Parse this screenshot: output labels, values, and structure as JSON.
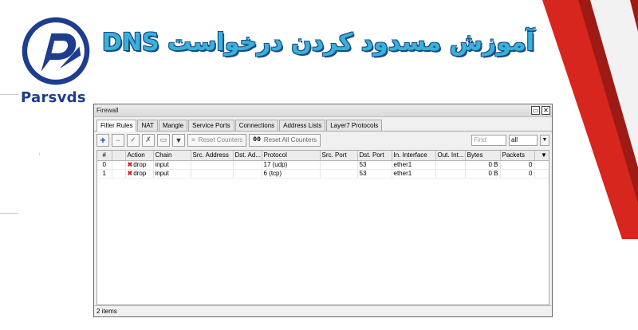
{
  "brand": {
    "name": "Parsvds"
  },
  "headline": "آموزش مسدود کردن درخواست DNS",
  "colors": {
    "brand_blue": "#1d3d8f",
    "headline_cyan": "#39b1d8",
    "accent_red": "#d7261e",
    "drop_red": "#d02020"
  },
  "window": {
    "title": "Firewall",
    "controls": {
      "restore": "▭",
      "close": "✕"
    },
    "tabs": [
      "Filter Rules",
      "NAT",
      "Mangle",
      "Service Ports",
      "Connections",
      "Address Lists",
      "Layer7 Protocols"
    ],
    "active_tab": "Filter Rules",
    "toolbar": {
      "add": "+",
      "remove": "−",
      "enable": "✓",
      "disable": "✗",
      "comment": "▭",
      "filter": "▼",
      "reset_counters": "Reset Counters",
      "reset_counters_icon": "≡",
      "reset_all_counters": "Reset All Counters",
      "reset_all_counters_icon": "00",
      "find_placeholder": "Find",
      "filter_select": "all",
      "filter_select_button": "▼"
    },
    "table": {
      "columns": [
        "#",
        "",
        "Action",
        "Chain",
        "Src. Address",
        "Dst. Ad...",
        "Protocol",
        "Src. Port",
        "Dst. Port",
        "In. Interface",
        "Out. Int...",
        "Bytes",
        "Packets",
        "▼"
      ],
      "rows": [
        {
          "num": "0",
          "action": "drop",
          "chain": "input",
          "src_address": "",
          "dst_address": "",
          "protocol": "17 (udp)",
          "src_port": "",
          "dst_port": "53",
          "in_interface": "ether1",
          "out_interface": "",
          "bytes": "0 B",
          "packets": "0"
        },
        {
          "num": "1",
          "action": "drop",
          "chain": "input",
          "src_address": "",
          "dst_address": "",
          "protocol": "6 (tcp)",
          "src_port": "",
          "dst_port": "53",
          "in_interface": "ether1",
          "out_interface": "",
          "bytes": "0 B",
          "packets": "0"
        }
      ]
    },
    "status": "2 items"
  }
}
